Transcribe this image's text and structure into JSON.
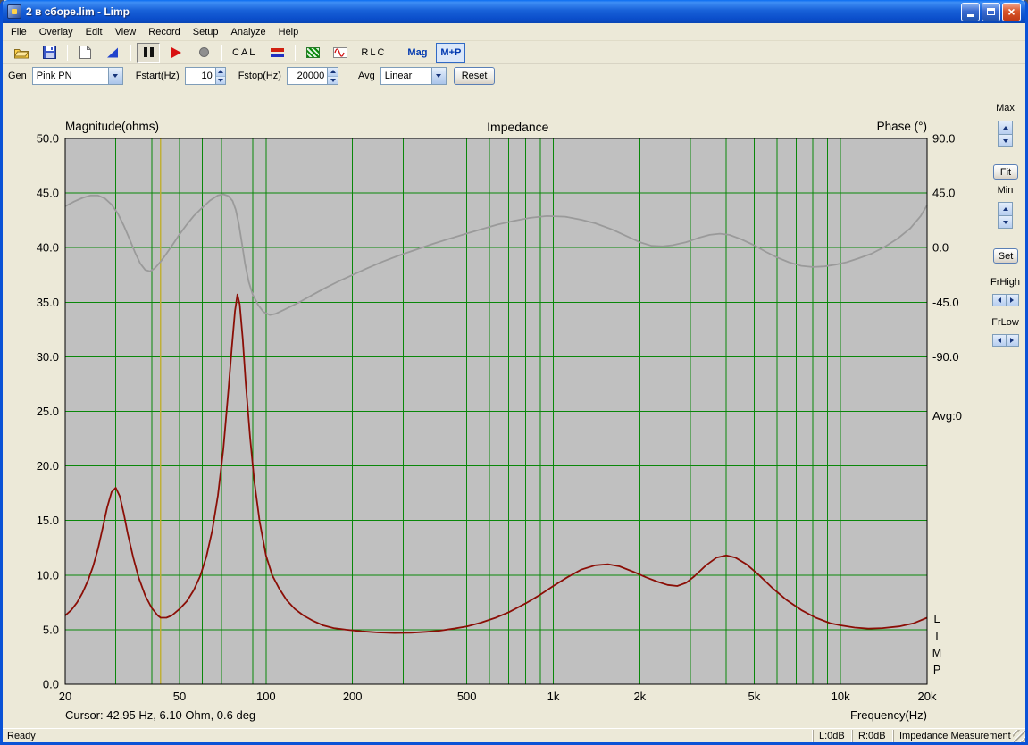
{
  "window": {
    "title": "2 в сборе.lim - Limp",
    "close_glyph": "×"
  },
  "menu": {
    "items": [
      "File",
      "Overlay",
      "Edit",
      "View",
      "Record",
      "Setup",
      "Analyze",
      "Help"
    ]
  },
  "toolbar": {
    "cal": "CAL",
    "rlc": "RLC",
    "mag": "Mag",
    "mp": "M+P"
  },
  "controls": {
    "gen_label": "Gen",
    "gen_value": "Pink PN",
    "fstart_label": "Fstart(Hz)",
    "fstart_value": "10",
    "fstop_label": "Fstop(Hz)",
    "fstop_value": "20000",
    "avg_label": "Avg",
    "avg_value": "Linear",
    "reset": "Reset"
  },
  "side_panel": {
    "max": "Max",
    "fit": "Fit",
    "min": "Min",
    "set": "Set",
    "frhigh": "FrHigh",
    "frlow": "FrLow"
  },
  "chart_labels": {
    "magnitude_axis": "Magnitude(ohms)",
    "title": "Impedance",
    "phase_axis": "Phase (°)",
    "avg_counter": "Avg:0",
    "watermark": [
      "L",
      "I",
      "M",
      "P"
    ],
    "cursor_readout": "Cursor: 42.95 Hz, 6.10 Ohm, 0.6 deg",
    "x_axis": "Frequency(Hz)"
  },
  "status": {
    "ready": "Ready",
    "left_level": "L:0dB",
    "right_level": "R:0dB",
    "mode": "Impedance Measurement"
  },
  "chart_data": {
    "type": "line",
    "title": "Impedance",
    "xlabel": "Frequency(Hz)",
    "ylabel_left": "Magnitude(ohms)",
    "ylabel_right": "Phase (°)",
    "x_scale": "log",
    "x_range": [
      20,
      20000
    ],
    "grid_freqs": [
      20,
      30,
      40,
      50,
      60,
      70,
      80,
      90,
      100,
      200,
      300,
      400,
      500,
      600,
      700,
      800,
      900,
      1000,
      2000,
      3000,
      4000,
      5000,
      6000,
      7000,
      8000,
      9000,
      10000,
      20000
    ],
    "x_ticks": [
      [
        20,
        "20"
      ],
      [
        50,
        "50"
      ],
      [
        100,
        "100"
      ],
      [
        200,
        "200"
      ],
      [
        500,
        "500"
      ],
      [
        1000,
        "1k"
      ],
      [
        2000,
        "2k"
      ],
      [
        5000,
        "5k"
      ],
      [
        10000,
        "10k"
      ],
      [
        20000,
        "20k"
      ]
    ],
    "left_axis": {
      "range": [
        0,
        50
      ],
      "tick_step": 5
    },
    "right_axis": {
      "ticks_deg": [
        90,
        45,
        0,
        -45,
        -90
      ],
      "zero_at_ohm": 40,
      "deg_per_ohm": 9
    },
    "cursor": {
      "freq_hz": 42.95,
      "ohm": 6.1,
      "deg": 0.6
    },
    "averages": 0,
    "grid_on": true,
    "colors": {
      "plot_bg": "#c0c0c0",
      "grid": "#0a870a",
      "magnitude": "#8b0e06",
      "phase": "#9a9a9a",
      "cursor": "#bfae2e"
    },
    "series": [
      {
        "name": "Impedance magnitude",
        "axis": "left",
        "unit": "ohm",
        "color": "#8b0e06",
        "points": [
          [
            20,
            6.3
          ],
          [
            21,
            6.8
          ],
          [
            22,
            7.5
          ],
          [
            23,
            8.4
          ],
          [
            24,
            9.5
          ],
          [
            25,
            10.8
          ],
          [
            26,
            12.4
          ],
          [
            27,
            14.3
          ],
          [
            28,
            16.2
          ],
          [
            29,
            17.6
          ],
          [
            30,
            18
          ],
          [
            31,
            17.2
          ],
          [
            32,
            15.6
          ],
          [
            33,
            13.8
          ],
          [
            34.5,
            11.6
          ],
          [
            36,
            9.8
          ],
          [
            38,
            8.1
          ],
          [
            40,
            7
          ],
          [
            42,
            6.3
          ],
          [
            43,
            6.1
          ],
          [
            45,
            6.1
          ],
          [
            47,
            6.3
          ],
          [
            50,
            6.9
          ],
          [
            53,
            7.6
          ],
          [
            56,
            8.6
          ],
          [
            59,
            9.9
          ],
          [
            62,
            11.7
          ],
          [
            65,
            14.1
          ],
          [
            68,
            17.3
          ],
          [
            71,
            21.5
          ],
          [
            74,
            27
          ],
          [
            76,
            30.8
          ],
          [
            78,
            34.2
          ],
          [
            79.5,
            35.7
          ],
          [
            81,
            34.8
          ],
          [
            83,
            31.6
          ],
          [
            85,
            27.6
          ],
          [
            88,
            22.6
          ],
          [
            91,
            18.6
          ],
          [
            95,
            14.9
          ],
          [
            100,
            11.8
          ],
          [
            105,
            10
          ],
          [
            111,
            8.8
          ],
          [
            118,
            7.7
          ],
          [
            126,
            6.9
          ],
          [
            135,
            6.3
          ],
          [
            146,
            5.8
          ],
          [
            158,
            5.4
          ],
          [
            172,
            5.15
          ],
          [
            190,
            5
          ],
          [
            215,
            4.85
          ],
          [
            245,
            4.75
          ],
          [
            280,
            4.7
          ],
          [
            320,
            4.72
          ],
          [
            360,
            4.8
          ],
          [
            400,
            4.9
          ],
          [
            450,
            5.1
          ],
          [
            500,
            5.3
          ],
          [
            560,
            5.65
          ],
          [
            630,
            6.1
          ],
          [
            700,
            6.6
          ],
          [
            800,
            7.4
          ],
          [
            900,
            8.2
          ],
          [
            1000,
            9
          ],
          [
            1120,
            9.8
          ],
          [
            1250,
            10.5
          ],
          [
            1400,
            10.9
          ],
          [
            1550,
            11
          ],
          [
            1700,
            10.8
          ],
          [
            1900,
            10.3
          ],
          [
            2100,
            9.8
          ],
          [
            2300,
            9.4
          ],
          [
            2500,
            9.1
          ],
          [
            2700,
            9
          ],
          [
            2900,
            9.3
          ],
          [
            3100,
            9.9
          ],
          [
            3400,
            10.9
          ],
          [
            3700,
            11.6
          ],
          [
            4000,
            11.8
          ],
          [
            4300,
            11.6
          ],
          [
            4700,
            11
          ],
          [
            5200,
            10
          ],
          [
            5800,
            8.8
          ],
          [
            6500,
            7.7
          ],
          [
            7300,
            6.8
          ],
          [
            8200,
            6.1
          ],
          [
            9200,
            5.6
          ],
          [
            10000,
            5.4
          ],
          [
            11200,
            5.2
          ],
          [
            12500,
            5.1
          ],
          [
            14000,
            5.15
          ],
          [
            16000,
            5.3
          ],
          [
            18000,
            5.6
          ],
          [
            20000,
            6.1
          ]
        ]
      },
      {
        "name": "Impedance phase",
        "axis": "right",
        "unit": "deg",
        "color": "#9a9a9a",
        "points": [
          [
            20,
            34
          ],
          [
            21.5,
            38
          ],
          [
            23,
            41
          ],
          [
            24.5,
            43
          ],
          [
            26,
            43
          ],
          [
            27.5,
            40.5
          ],
          [
            29,
            35.5
          ],
          [
            30.5,
            28
          ],
          [
            32,
            18
          ],
          [
            33.5,
            7
          ],
          [
            35,
            -4
          ],
          [
            36.5,
            -13
          ],
          [
            38,
            -18.5
          ],
          [
            39.5,
            -19.5
          ],
          [
            41,
            -17
          ],
          [
            43,
            -11.5
          ],
          [
            45,
            -5
          ],
          [
            47.5,
            3
          ],
          [
            50,
            11
          ],
          [
            53,
            19
          ],
          [
            56,
            26
          ],
          [
            60,
            33
          ],
          [
            64,
            39
          ],
          [
            68,
            43
          ],
          [
            71,
            44
          ],
          [
            74,
            42.5
          ],
          [
            76.5,
            38.5
          ],
          [
            78.5,
            31
          ],
          [
            80.5,
            19
          ],
          [
            82.5,
            3
          ],
          [
            84.5,
            -13
          ],
          [
            87,
            -28
          ],
          [
            90,
            -39
          ],
          [
            94,
            -47.5
          ],
          [
            98,
            -53
          ],
          [
            103,
            -55.5
          ],
          [
            108,
            -54.5
          ],
          [
            115,
            -51.5
          ],
          [
            123,
            -48
          ],
          [
            133,
            -44
          ],
          [
            145,
            -39
          ],
          [
            160,
            -33.5
          ],
          [
            180,
            -27.5
          ],
          [
            200,
            -22.5
          ],
          [
            225,
            -17
          ],
          [
            255,
            -11.5
          ],
          [
            290,
            -6.5
          ],
          [
            330,
            -2
          ],
          [
            380,
            3
          ],
          [
            430,
            7
          ],
          [
            490,
            11
          ],
          [
            560,
            15
          ],
          [
            640,
            19
          ],
          [
            730,
            22
          ],
          [
            830,
            24.5
          ],
          [
            950,
            26
          ],
          [
            1100,
            25.5
          ],
          [
            1250,
            23
          ],
          [
            1400,
            20
          ],
          [
            1600,
            15
          ],
          [
            1800,
            9.5
          ],
          [
            2000,
            4.5
          ],
          [
            2200,
            1.5
          ],
          [
            2400,
            1
          ],
          [
            2600,
            2
          ],
          [
            2900,
            4.5
          ],
          [
            3200,
            8
          ],
          [
            3500,
            10.5
          ],
          [
            3800,
            11.5
          ],
          [
            4100,
            10.5
          ],
          [
            4500,
            7
          ],
          [
            5000,
            2
          ],
          [
            5500,
            -3.5
          ],
          [
            6000,
            -8
          ],
          [
            6600,
            -12
          ],
          [
            7300,
            -15
          ],
          [
            8000,
            -16
          ],
          [
            8800,
            -15.5
          ],
          [
            9600,
            -14
          ],
          [
            10500,
            -12
          ],
          [
            11500,
            -9
          ],
          [
            12800,
            -5
          ],
          [
            14200,
            0.5
          ],
          [
            15800,
            7.5
          ],
          [
            17500,
            16
          ],
          [
            19000,
            26
          ],
          [
            20000,
            35
          ]
        ]
      }
    ]
  }
}
